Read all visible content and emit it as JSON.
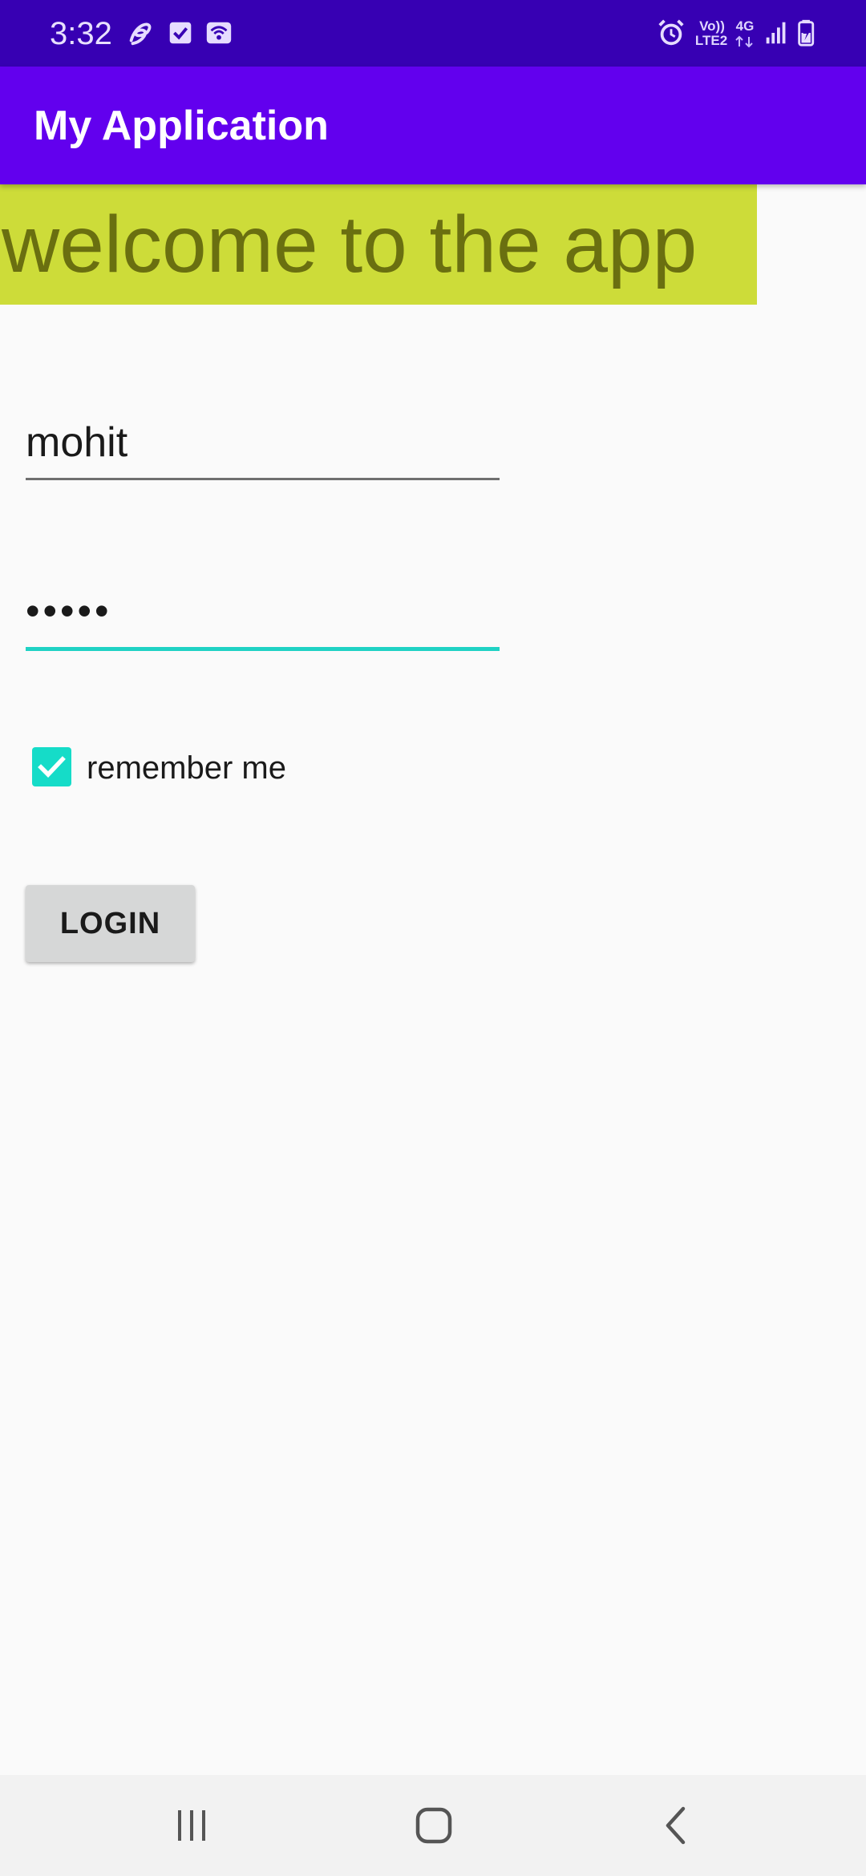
{
  "status_bar": {
    "time": "3:32",
    "volte_label_top": "Vo))",
    "volte_label_bottom": "LTE2",
    "network_label": "4G",
    "icons": [
      "airtel-icon",
      "task-check-icon",
      "wifi-calling-icon",
      "alarm-icon",
      "signal-icon",
      "battery-charging-icon"
    ]
  },
  "app_bar": {
    "title": "My Application"
  },
  "welcome": {
    "text": "welcome to the app",
    "background": "#cddc39",
    "text_color": "#6a6f10"
  },
  "form": {
    "username_value": "mohit",
    "password_value": "•••••",
    "remember_label": "remember me",
    "remember_checked": true,
    "login_label": "LOGIN"
  },
  "colors": {
    "status_bar": "#3700b3",
    "app_bar": "#6200ee",
    "accent": "#1fd2c4"
  },
  "nav_bar": {
    "icons": [
      "recents-icon",
      "home-icon",
      "back-icon"
    ]
  }
}
